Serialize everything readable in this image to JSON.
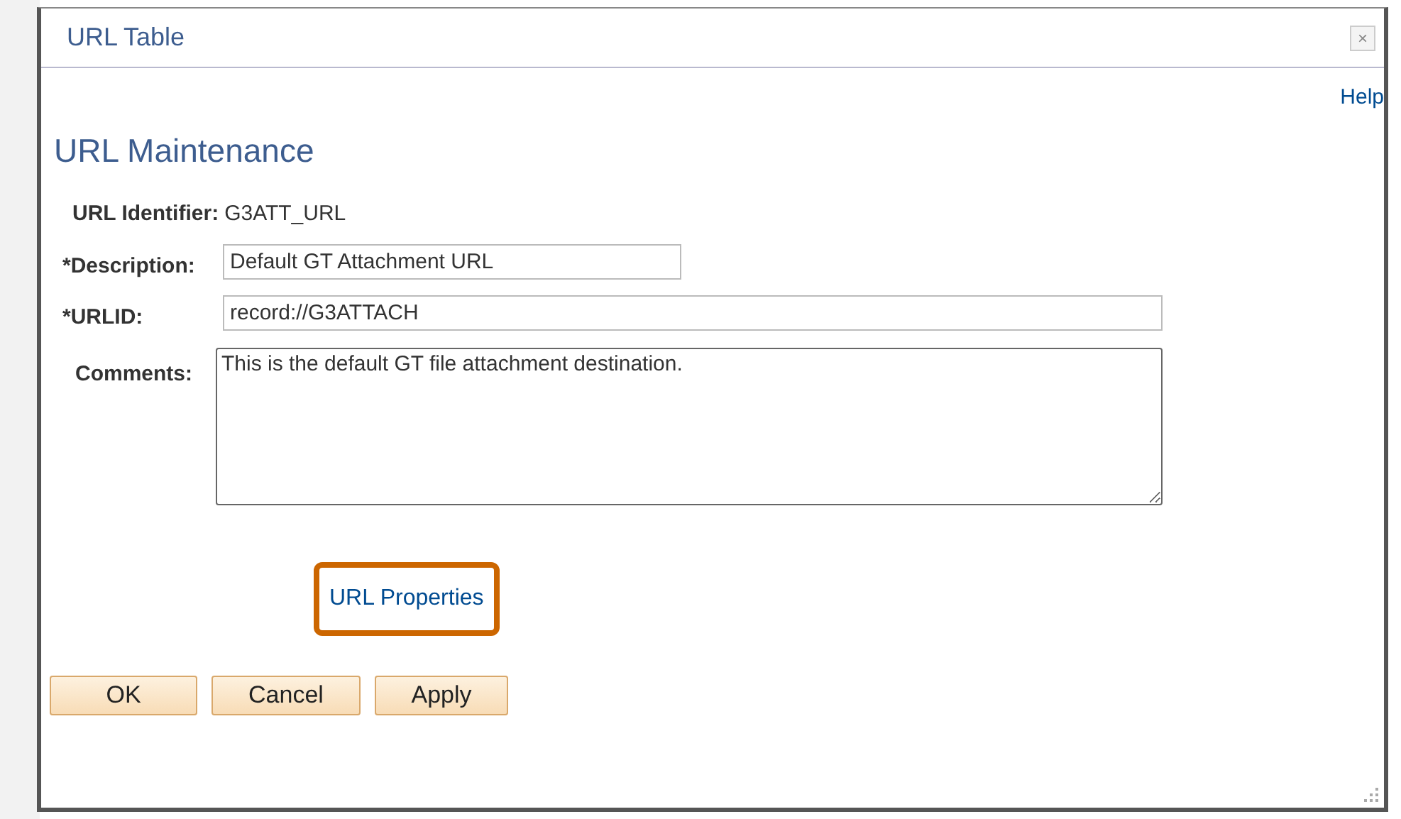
{
  "window": {
    "title": "URL Table",
    "close": "×"
  },
  "help": "Help",
  "heading": "URL Maintenance",
  "fields": [
    {
      "kind": "static",
      "label": "URL Identifier:",
      "value": "G3ATT_URL"
    },
    {
      "kind": "shortinput",
      "label": "*Description:",
      "value": "Default GT Attachment URL"
    },
    {
      "kind": "longinput",
      "label": "*URLID:",
      "value": "record://G3ATTACH"
    },
    {
      "kind": "textarea",
      "label": "Comments:",
      "value": "This is the default GT file attachment destination."
    }
  ],
  "link": {
    "label": "URL Properties",
    "highlighted": true
  },
  "buttons": [
    "OK",
    "Cancel",
    "Apply"
  ]
}
